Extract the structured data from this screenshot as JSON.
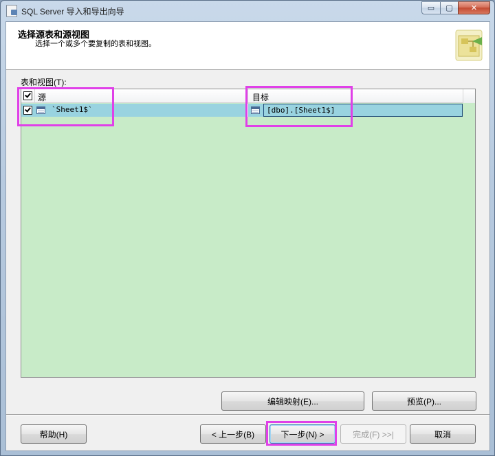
{
  "window": {
    "title": "SQL Server 导入和导出向导",
    "controls": {
      "minimize": "▭",
      "maximize": "▢",
      "close": "✕"
    }
  },
  "header": {
    "title": "选择源表和源视图",
    "subtitle": "选择一个或多个要复制的表和视图。"
  },
  "tables_label": "表和视图(T):",
  "grid": {
    "columns": {
      "source": "源",
      "target": "目标"
    },
    "header_checked": true,
    "rows": [
      {
        "checked": true,
        "source": "`Sheet1$`",
        "target": "[dbo].[Sheet1$]"
      }
    ]
  },
  "buttons": {
    "edit_mappings": "编辑映射(E)...",
    "preview": "预览(P)...",
    "help": "帮助(H)",
    "back": "< 上一步(B)",
    "next": "下一步(N) >",
    "finish": "完成(F) >>|",
    "cancel": "取消"
  },
  "colors": {
    "grid_background": "#c8ebc8",
    "selected_row": "#99d3e0",
    "highlight": "#e040e8"
  }
}
